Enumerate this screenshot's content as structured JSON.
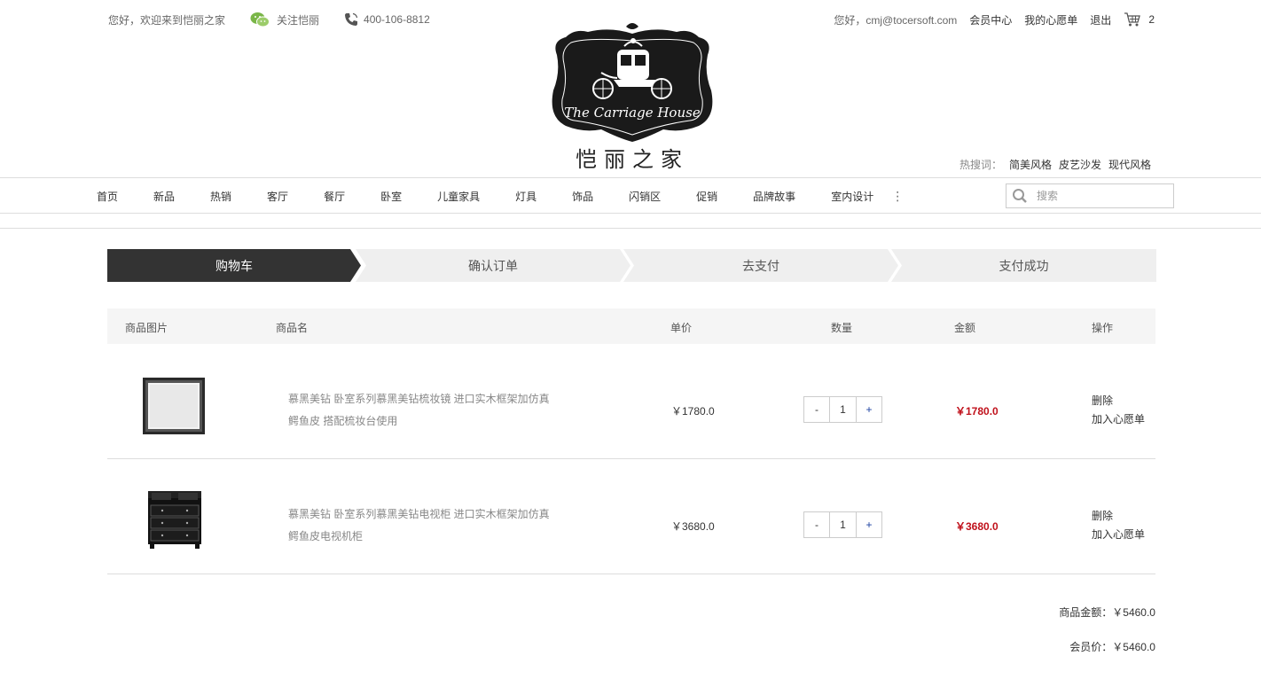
{
  "topbar": {
    "welcome": "您好，欢迎来到恺丽之家",
    "follow": "关注恺丽",
    "phone": "400-106-8812",
    "hello": "您好，cmj@tocersoft.com",
    "member_center": "会员中心",
    "wishlist": "我的心愿单",
    "logout": "退出",
    "cart_count": "2"
  },
  "logo": {
    "script": "The Carriage House",
    "cn": "恺丽之家"
  },
  "hot": {
    "label": "热搜词：",
    "words": [
      "简美风格",
      "皮艺沙发",
      "现代风格"
    ]
  },
  "nav": {
    "items": [
      "首页",
      "新品",
      "热销",
      "客厅",
      "餐厅",
      "卧室",
      "儿童家具",
      "灯具",
      "饰品",
      "闪销区",
      "促销",
      "品牌故事",
      "室内设计"
    ],
    "more": "⋮",
    "search_placeholder": "搜索"
  },
  "steps": [
    "购物车",
    "确认订单",
    "去支付",
    "支付成功"
  ],
  "table": {
    "headers": {
      "image": "商品图片",
      "name": "商品名",
      "price": "单价",
      "qty": "数量",
      "amount": "金额",
      "ops": "操作"
    },
    "rows": [
      {
        "name_line1": "慕黑美钻 卧室系列慕黑美钻梳妆镜 进口实木框架加仿真",
        "name_line2": "鳄鱼皮 搭配梳妆台使用",
        "price": "￥1780.0",
        "qty": "1",
        "amount": "￥1780.0",
        "delete": "删除",
        "add_wish": "加入心愿单"
      },
      {
        "name_line1": "慕黑美钻 卧室系列慕黑美钻电视柜 进口实木框架加仿真",
        "name_line2": "鳄鱼皮电视机柜",
        "price": "￥3680.0",
        "qty": "1",
        "amount": "￥3680.0",
        "delete": "删除",
        "add_wish": "加入心愿单"
      }
    ],
    "minus": "-",
    "plus": "+"
  },
  "totals": {
    "goods_label": "商品金额：",
    "goods_value": "￥5460.0",
    "member_label": "会员价：",
    "member_value": "￥5460.0"
  },
  "colors": {
    "accent_red": "#c0111b",
    "step_active": "#333333",
    "step_inactive": "#efefef"
  }
}
